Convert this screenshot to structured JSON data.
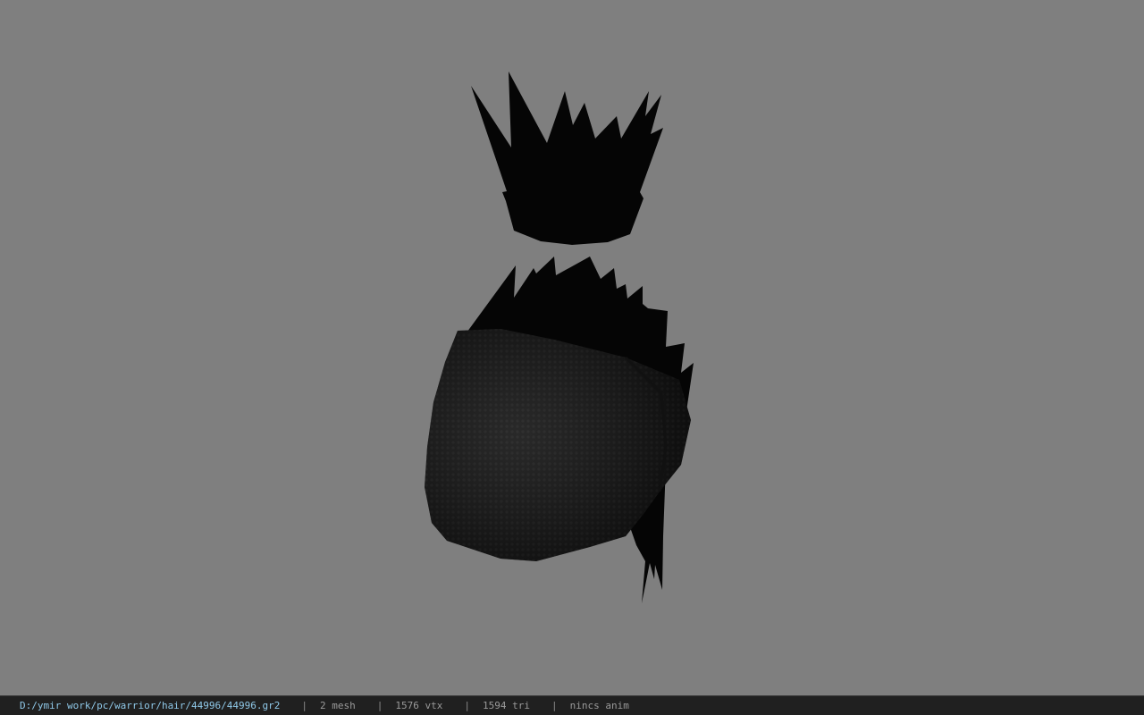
{
  "viewer": {
    "background_color": "#7f7f7f",
    "model_color": "#0a0a0a",
    "model_icon": "hair-mesh-model"
  },
  "status_bar": {
    "file_path": "D:/ymir work/pc/warrior/hair/44996/44996.gr2",
    "separator": "|",
    "mesh_count": "2 mesh",
    "vertex_count": "1576 vtx",
    "triangle_count": "1594 tri",
    "animation": "nincs anim"
  }
}
